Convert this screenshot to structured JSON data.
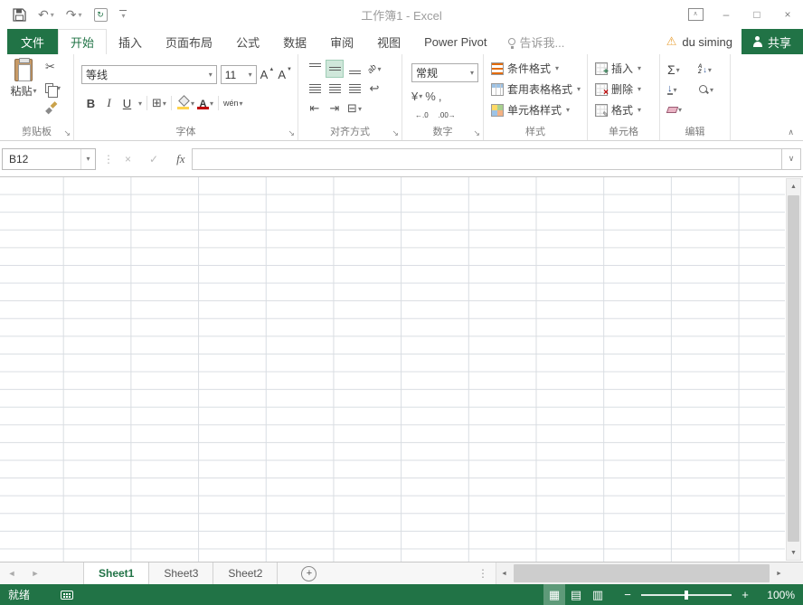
{
  "window": {
    "title": "工作簿1 - Excel"
  },
  "icons": {
    "undo": "↶",
    "redo": "↷",
    "caret": "▾",
    "refresh": "↻",
    "chevron_up": "∧",
    "chevron_down": "∨",
    "minimize": "–",
    "maximize": "□",
    "close": "×",
    "warning": "⚠",
    "cut": "✂",
    "grow_font": "A",
    "shrink_font": "A",
    "up_small": "▲",
    "down_small": "▼",
    "bold": "B",
    "italic": "I",
    "underline": "U",
    "border": "⊞",
    "font_color": "A",
    "phonetic": "wén",
    "orientation": "ab",
    "wrap_text": "↩",
    "merge_center": "⊟",
    "indent_decrease": "⇤",
    "indent_increase": "⇥",
    "currency": "¥",
    "percent": "%",
    "comma": ",",
    "increase_decimal": "←.0",
    "decrease_decimal": ".00→",
    "sigma": "Σ",
    "sort_a": "A",
    "sort_z": "Z",
    "arrow_down": "↓",
    "fill_down": "↓",
    "dialog_launcher": "↘",
    "dots_vertical": "⋮",
    "cancel": "×",
    "enter": "✓",
    "fx": "fx",
    "scroll_up": "▲",
    "scroll_down": "▼",
    "scroll_left": "◄",
    "scroll_right": "►",
    "nav_left": "◄",
    "nav_right": "►",
    "add_sheet": "+",
    "view_normal": "▦",
    "view_page_layout": "▤",
    "view_page_break": "▥",
    "zoom_out": "−",
    "zoom_in": "+"
  },
  "tabs": {
    "file": "文件",
    "home": "开始",
    "insert": "插入",
    "page_layout": "页面布局",
    "formulas": "公式",
    "data": "数据",
    "review": "审阅",
    "view": "视图",
    "power_pivot": "Power Pivot",
    "tell_me": "告诉我...",
    "user": "du siming",
    "share": "共享"
  },
  "ribbon": {
    "clipboard": {
      "label": "剪贴板",
      "paste": "粘贴"
    },
    "font": {
      "label": "字体",
      "name": "等线",
      "size": "11"
    },
    "alignment": {
      "label": "对齐方式"
    },
    "number": {
      "label": "数字",
      "format": "常规"
    },
    "styles": {
      "label": "样式",
      "conditional_formatting": "条件格式",
      "format_as_table": "套用表格格式",
      "cell_styles": "单元格样式"
    },
    "cells": {
      "label": "单元格",
      "insert": "插入",
      "delete": "删除",
      "format": "格式"
    },
    "editing": {
      "label": "编辑"
    }
  },
  "formula_bar": {
    "name_box": "B12"
  },
  "sheet_bar": {
    "sheets": [
      "Sheet1",
      "Sheet3",
      "Sheet2"
    ]
  },
  "status_bar": {
    "ready": "就绪",
    "zoom_level": "100%"
  }
}
